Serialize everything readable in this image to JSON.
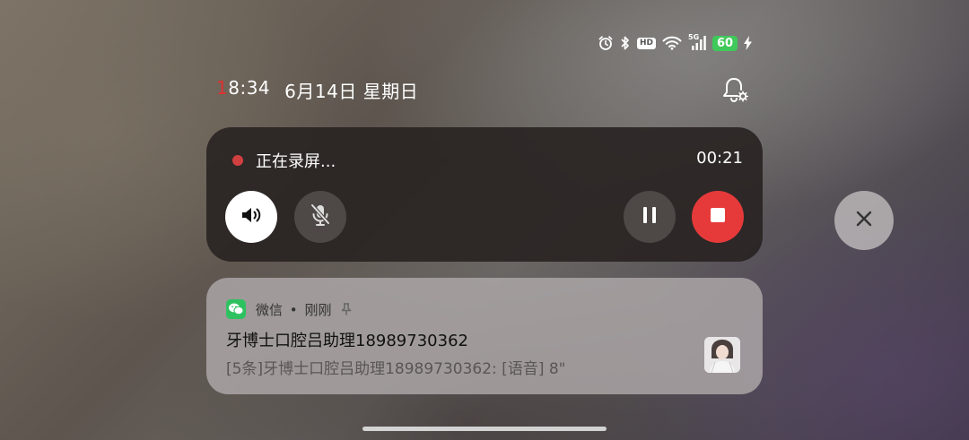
{
  "status_bar": {
    "icons": [
      "alarm-icon",
      "bluetooth-icon",
      "hd-icon",
      "wifi-icon",
      "signal-5g-icon",
      "battery-icon",
      "charging-icon"
    ],
    "hd_label": "HD",
    "network_label": "5G",
    "battery_level": "60",
    "battery_color": "#3fc95a"
  },
  "header": {
    "time": "18:34",
    "time_prefix": "1",
    "time_rest": "8:34",
    "date": "6月14日",
    "weekday": "星期日",
    "bell_icon": "notification-settings-icon"
  },
  "screen_recording": {
    "title": "正在录屏...",
    "elapsed": "00:21",
    "status_color": "#d04040",
    "controls": {
      "speaker": "speaker-icon",
      "mic": "mic-off-icon",
      "pause": "pause-icon",
      "stop": "stop-icon"
    },
    "stop_color": "#e63a3a"
  },
  "close_button": {
    "icon": "close-icon"
  },
  "notification": {
    "app_icon": "wechat-icon",
    "app_name": "微信",
    "separator": "•",
    "time": "刚刚",
    "pin_icon": "pin-icon",
    "title": "牙博士口腔吕助理18989730362",
    "body": "[5条]牙博士口腔吕助理18989730362: [语音] 8\"",
    "accent_color": "#2dc160"
  }
}
